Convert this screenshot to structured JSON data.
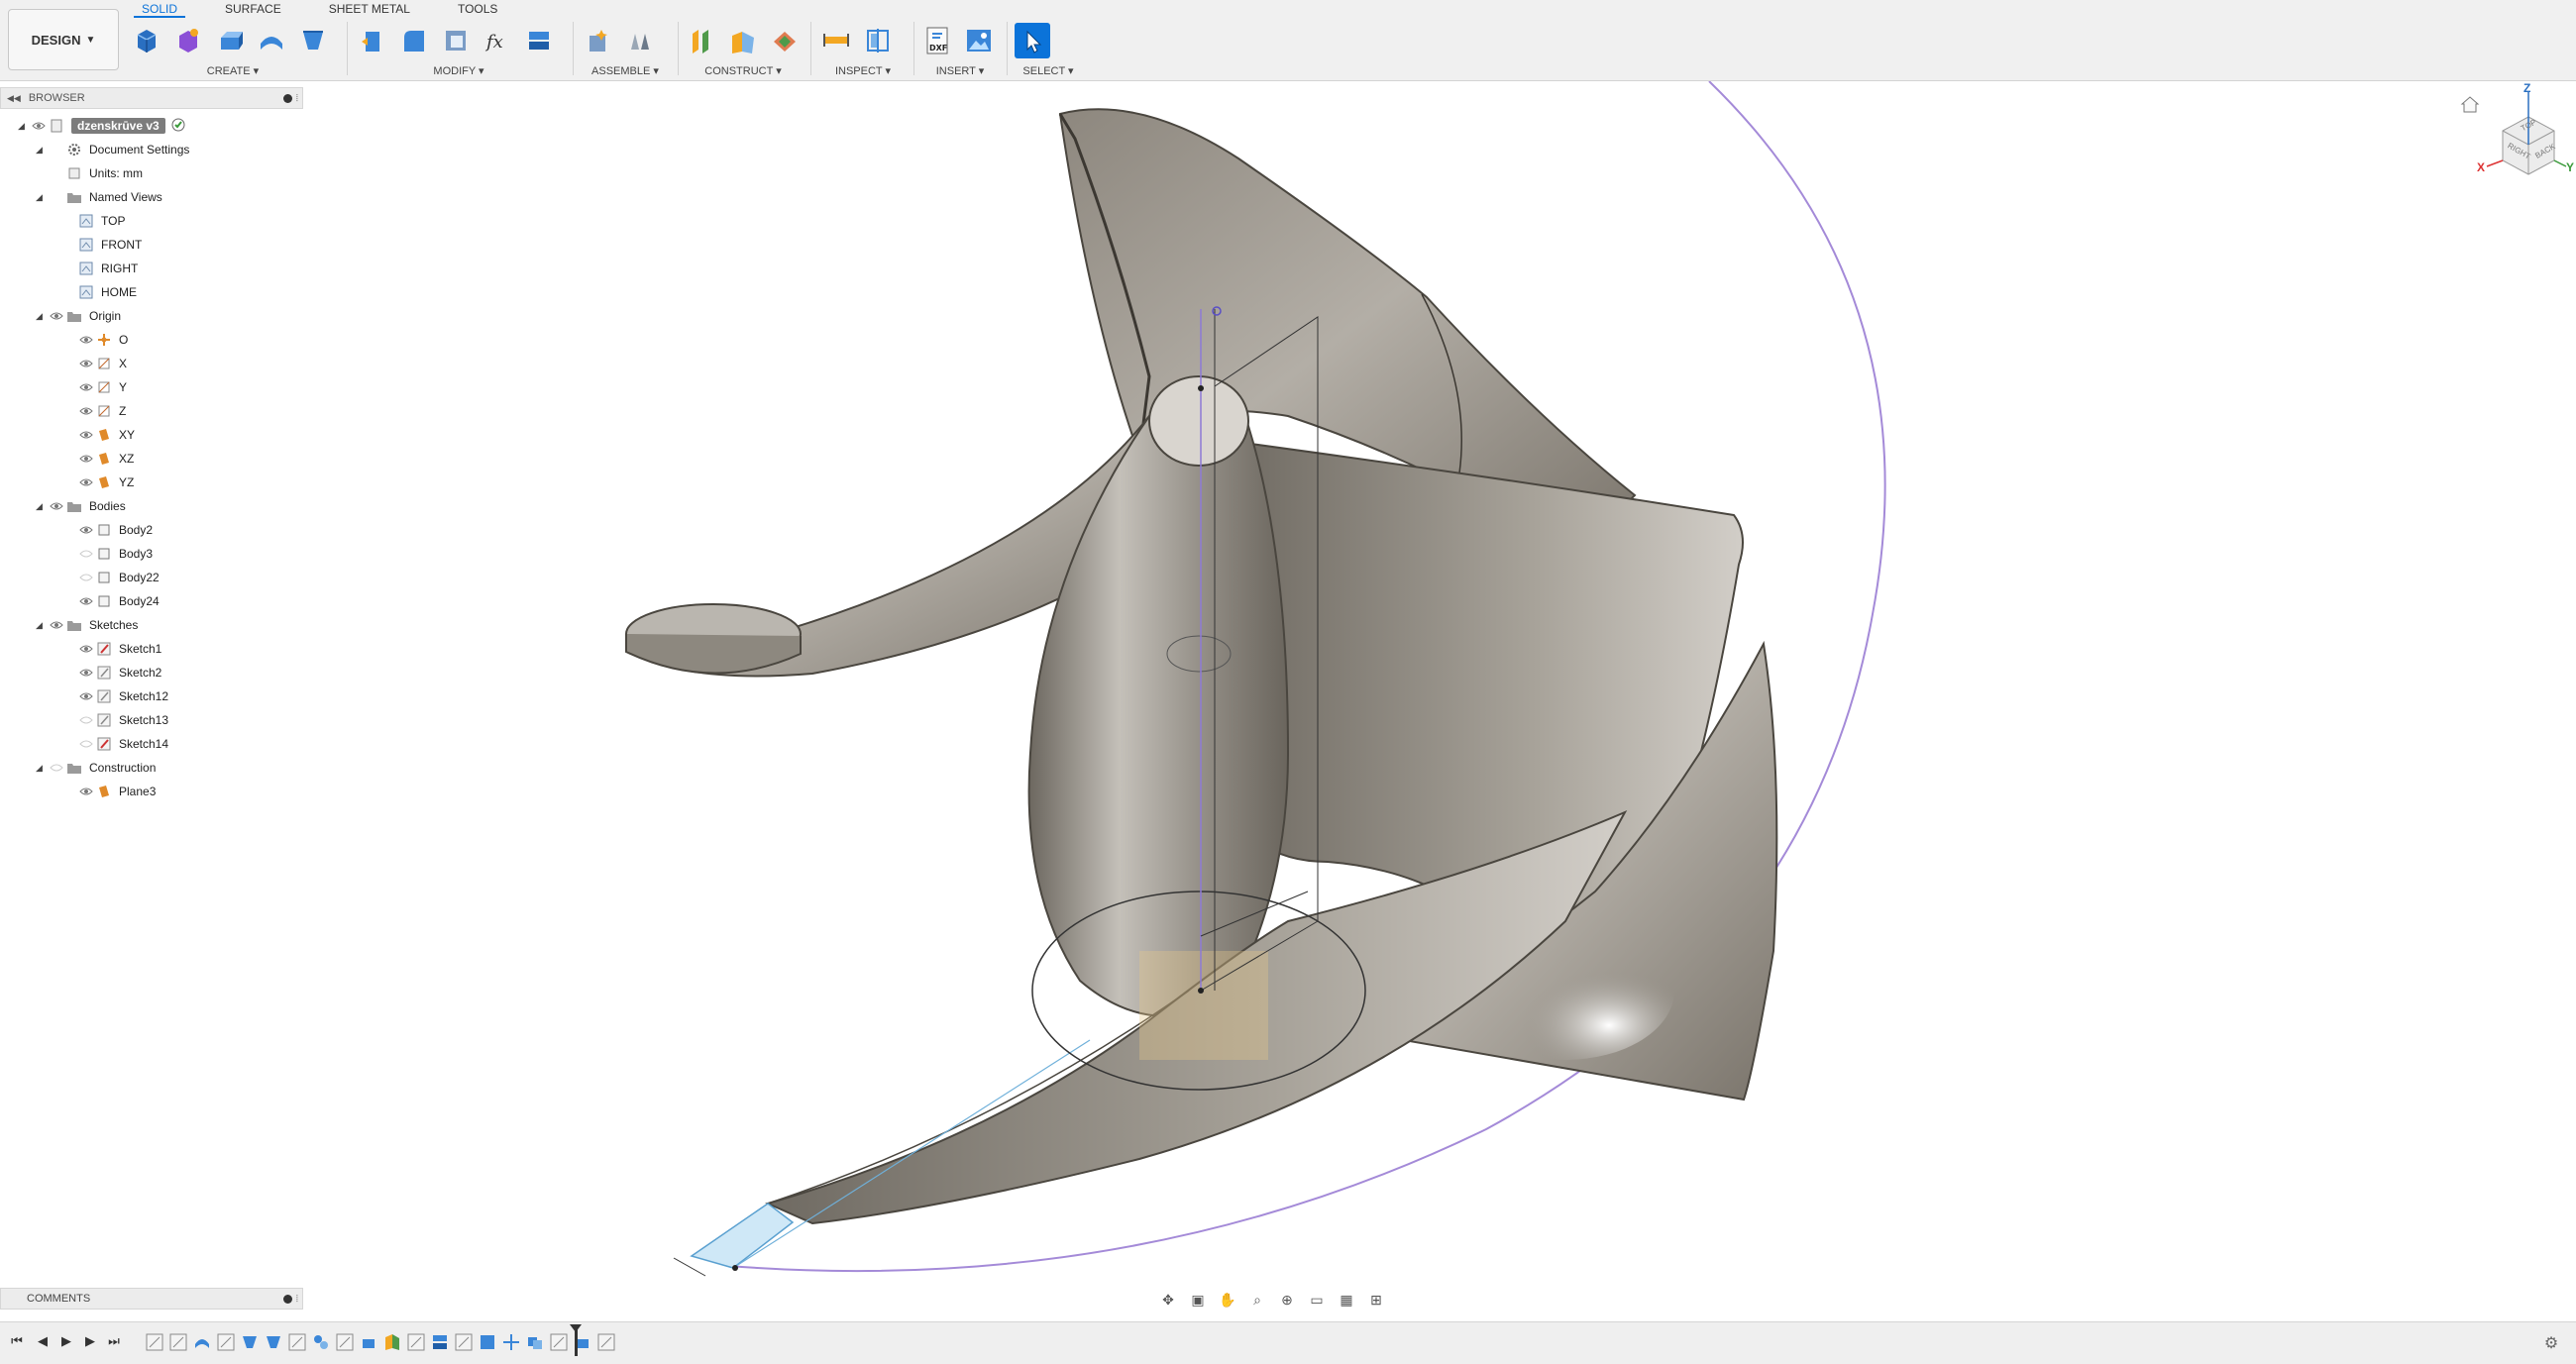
{
  "workspace": {
    "mode_label": "DESIGN"
  },
  "tabs": [
    {
      "label": "SOLID",
      "active": true
    },
    {
      "label": "SURFACE",
      "active": false
    },
    {
      "label": "SHEET METAL",
      "active": false
    },
    {
      "label": "TOOLS",
      "active": false
    }
  ],
  "toolbar_groups": {
    "create": "CREATE",
    "modify": "MODIFY",
    "assemble": "ASSEMBLE",
    "construct": "CONSTRUCT",
    "inspect": "INSPECT",
    "insert": "INSERT",
    "select": "SELECT"
  },
  "browser": {
    "title": "BROWSER",
    "root": "dzenskrūve v3",
    "document_settings": "Document Settings",
    "units": "Units: mm",
    "named_views": {
      "label": "Named Views",
      "items": [
        "TOP",
        "FRONT",
        "RIGHT",
        "HOME"
      ]
    },
    "origin": {
      "label": "Origin",
      "items": [
        "O",
        "X",
        "Y",
        "Z",
        "XY",
        "XZ",
        "YZ"
      ]
    },
    "bodies": {
      "label": "Bodies",
      "items": [
        "Body2",
        "Body3",
        "Body22",
        "Body24"
      ]
    },
    "sketches": {
      "label": "Sketches",
      "items": [
        "Sketch1",
        "Sketch2",
        "Sketch12",
        "Sketch13",
        "Sketch14"
      ]
    },
    "construction": {
      "label": "Construction",
      "items": [
        "Plane3"
      ]
    }
  },
  "comments": {
    "title": "COMMENTS"
  },
  "viewcube": {
    "axis_z": "Z",
    "axis_x": "X",
    "axis_y": "Y",
    "face_top": "TOP",
    "face_right": "RIGHT",
    "face_back": "BACK"
  },
  "colors": {
    "accent": "#0b73d9",
    "model": "#8e8a83",
    "sketch_purple": "#9a7fd6",
    "highlight": "#cfe8f7"
  }
}
